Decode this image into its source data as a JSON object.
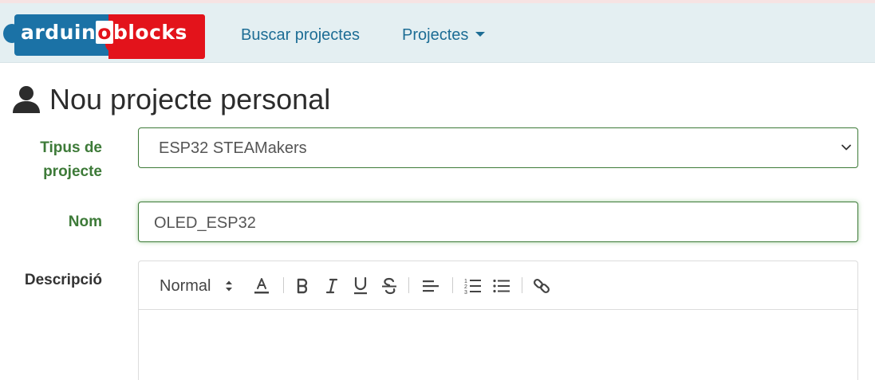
{
  "brand": {
    "logo_text_1": "arduin",
    "logo_text_2": "o",
    "logo_text_3": "blocks"
  },
  "nav": {
    "search_label": "Buscar projectes",
    "projects_label": "Projectes"
  },
  "page": {
    "title": "Nou projecte personal"
  },
  "form": {
    "type_label_line1": "Tipus de",
    "type_label_line2": "projecte",
    "type_value": "ESP32 STEAMakers",
    "name_label": "Nom",
    "name_value": "OLED_ESP32",
    "description_label": "Descripció"
  },
  "editor": {
    "header_select_value": "Normal",
    "tools": [
      "font-color-icon",
      "bold-icon",
      "italic-icon",
      "underline-icon",
      "strikethrough-icon",
      "align-icon",
      "ordered-list-icon",
      "bullet-list-icon",
      "link-icon"
    ]
  },
  "colors": {
    "navbar_bg": "#e4eff2",
    "nav_link": "#1d6d95",
    "label_green": "#3d7a38",
    "logo_blue": "#1b72a6",
    "logo_red": "#e3131b"
  }
}
